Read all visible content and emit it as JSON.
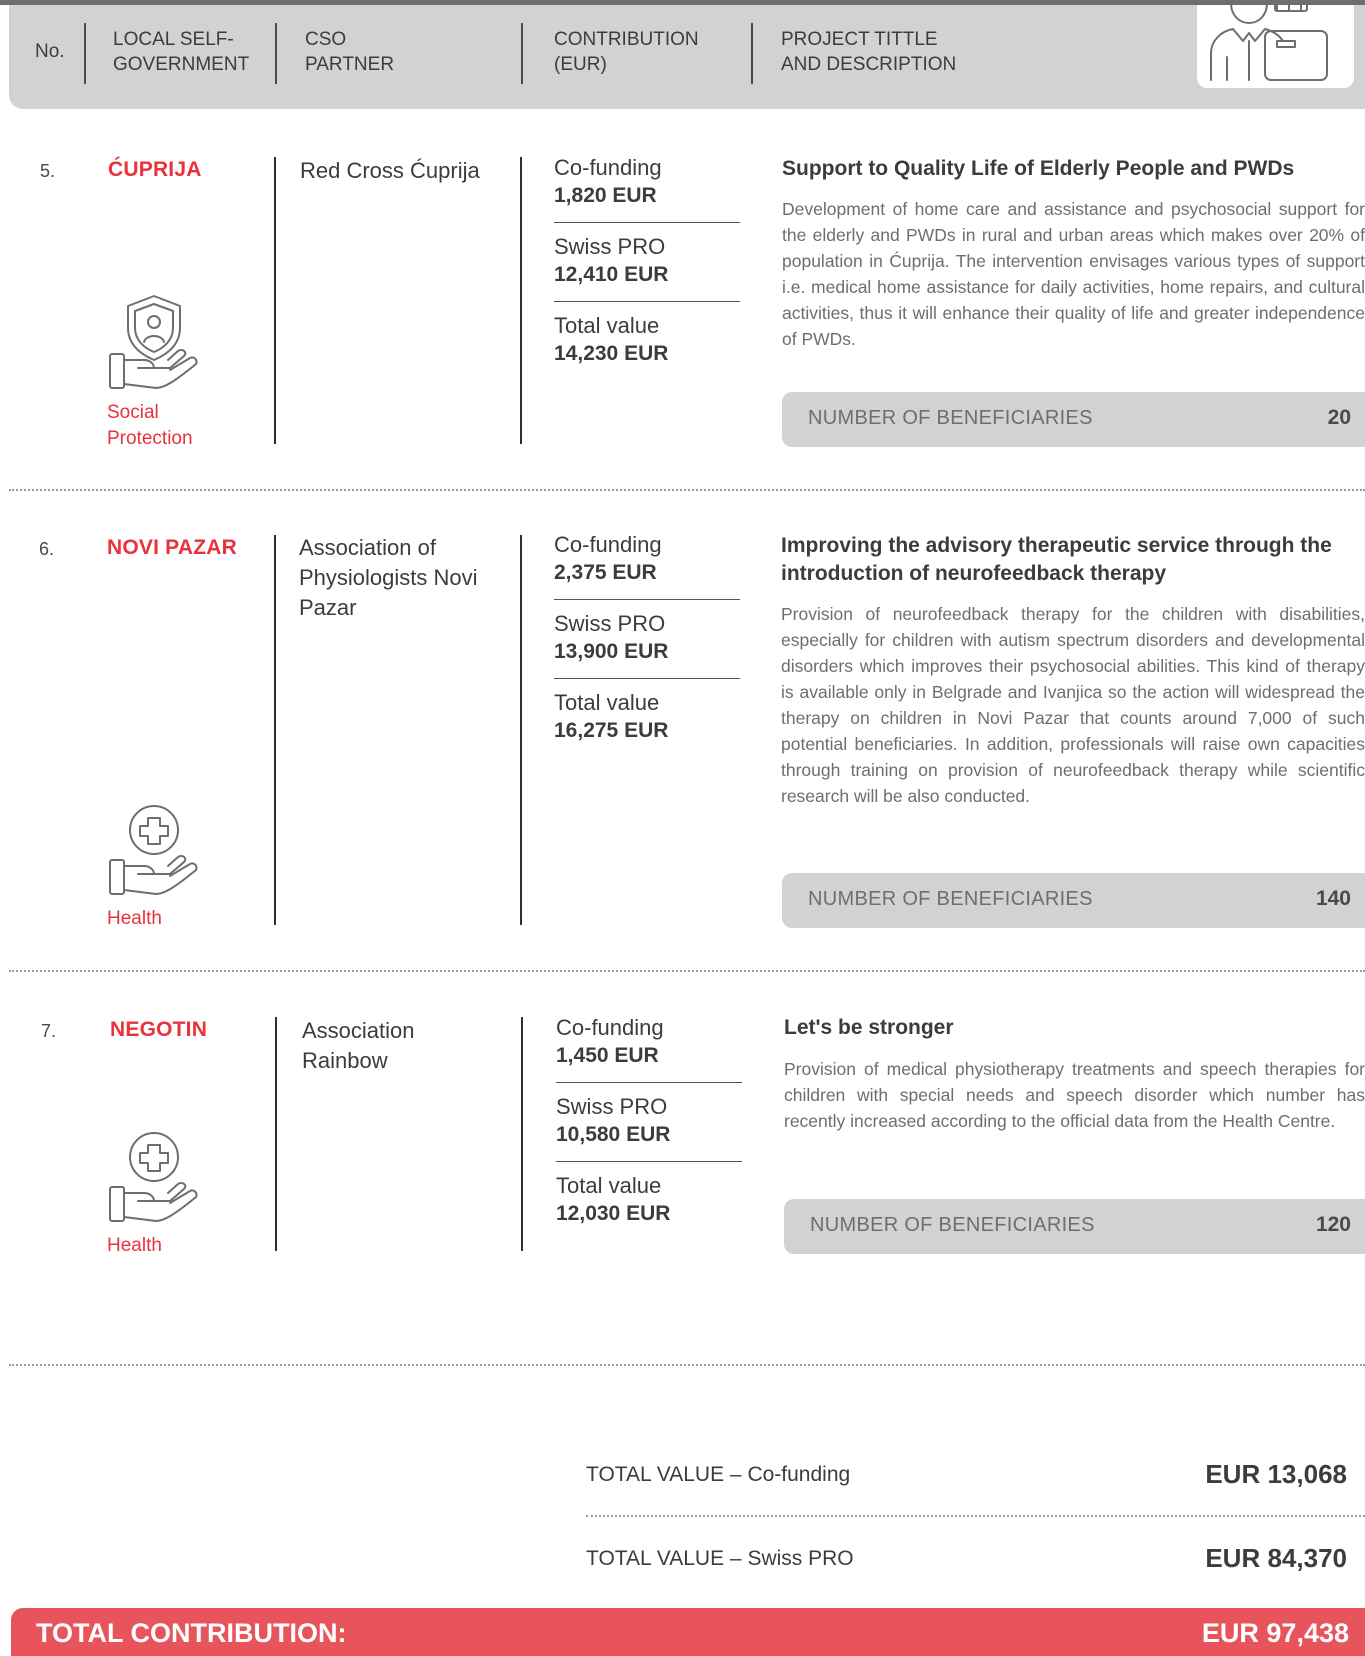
{
  "header": {
    "no": "No.",
    "local_line1": "LOCAL SELF-",
    "local_line2": "GOVERNMENT",
    "cso_line1": "CSO",
    "cso_line2": "PARTNER",
    "contrib_line1": "CONTRIBUTION",
    "contrib_line2": "(EUR)",
    "project_line1": "PROJECT TITTLE",
    "project_line2": "AND DESCRIPTION",
    "icon": "worker-with-box-icon"
  },
  "entries": [
    {
      "number": "5.",
      "city": "ĆUPRIJA",
      "partner": "Red Cross Ćuprija",
      "cofunding_label": "Co-funding",
      "cofunding_value": "1,820 EUR",
      "swiss_label": "Swiss PRO",
      "swiss_value": "12,410 EUR",
      "total_label": "Total value",
      "total_value": "14,230 EUR",
      "title": "Support to Quality Life of Elderly People and PWDs",
      "description": " Development of home care and assistance and psychosocial support for the elderly and PWDs in rural and urban areas which makes over 20% of population in Ćuprija. The intervention envisages various types of support i.e. medical home assistance for daily activities, home repairs, and cultural activities, thus it will enhance their quality of life and greater independence of PWDs.",
      "beneficiaries_label": "NUMBER OF BENEFICIARIES",
      "beneficiaries_value": "20",
      "category": "Social Protection",
      "category_icon": "social-protection-hand-shield-icon"
    },
    {
      "number": "6.",
      "city": "NOVI PAZAR",
      "partner": "Association of Physiologists Novi Pazar",
      "cofunding_label": "Co-funding",
      "cofunding_value": "2,375 EUR",
      "swiss_label": "Swiss PRO",
      "swiss_value": "13,900 EUR",
      "total_label": "Total value",
      "total_value": "16,275 EUR",
      "title": "Improving the advisory therapeutic service through the introduction of neurofeedback therapy",
      "description": "Provision of neurofeedback therapy for the children with disabilities, especially for children with autism spectrum disorders and  developmental disorders which improves their psychosocial abilities. This kind of therapy is available only in Belgrade and Ivanjica so the action will widespread the therapy on children in Novi Pazar that counts around 7,000 of such potential beneficiaries. In addition, professionals will raise own capacities through training on provision of neurofeedback therapy  while scientific research will be also conducted.",
      "beneficiaries_label": "NUMBER OF BENEFICIARIES",
      "beneficiaries_value": "140",
      "category": "Health",
      "category_icon": "health-hand-cross-icon"
    },
    {
      "number": "7.",
      "city": "NEGOTIN",
      "partner": "Association Rainbow",
      "cofunding_label": "Co-funding",
      "cofunding_value": "1,450 EUR",
      "swiss_label": "Swiss PRO",
      "swiss_value": "10,580 EUR",
      "total_label": "Total value",
      "total_value": "12,030 EUR",
      "title": "Let's be stronger",
      "description": "Provision of medical physiotherapy treatments and speech therapies for children with special needs and speech disorder which number has recently increased according to the official data from the Health Centre.",
      "beneficiaries_label": "NUMBER OF BENEFICIARIES",
      "beneficiaries_value": "120",
      "category": "Health",
      "category_icon": "health-hand-cross-icon"
    }
  ],
  "totals": {
    "cofunding_label": "TOTAL VALUE – Co-funding",
    "cofunding_value": "EUR 13,068",
    "swiss_label": "TOTAL VALUE – Swiss PRO",
    "swiss_value": "EUR 84,370",
    "contribution_label": "TOTAL CONTRIBUTION:",
    "contribution_value": "EUR 97,438"
  },
  "colors": {
    "accent_red": "#e8323c",
    "total_bar": "#e8545c",
    "header_gray": "#d1d2d4"
  }
}
